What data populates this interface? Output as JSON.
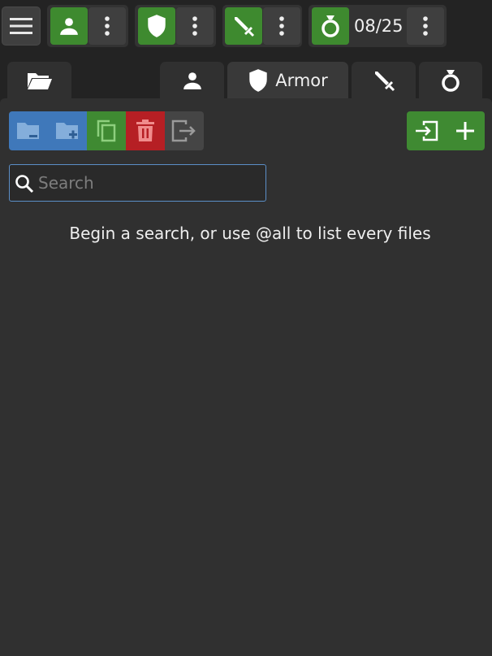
{
  "app": {
    "accent_green": "#3e8a2f",
    "accent_blue": "#3f78ba",
    "accent_red": "#b61f24",
    "background": "#232323"
  },
  "topbar": {
    "menu_icon": "hamburger-icon",
    "groups": [
      {
        "icon": "person-icon",
        "more_icon": "more-vertical-icon"
      },
      {
        "icon": "shield-icon",
        "more_icon": "more-vertical-icon"
      },
      {
        "icon": "sword-icon",
        "more_icon": "more-vertical-icon"
      },
      {
        "icon": "ring-icon",
        "counter": "08/25",
        "more_icon": "more-vertical-icon"
      }
    ]
  },
  "tabs": [
    {
      "icon": "folder-open-icon",
      "label": ""
    },
    {
      "icon": "person-icon",
      "label": ""
    },
    {
      "icon": "shield-icon",
      "label": "Armor"
    },
    {
      "icon": "sword-icon",
      "label": ""
    },
    {
      "icon": "ring-icon",
      "label": ""
    }
  ],
  "toolbar": {
    "left_tools": [
      {
        "icon": "folder-remove-icon"
      },
      {
        "icon": "folder-add-icon"
      },
      {
        "icon": "copy-icon"
      },
      {
        "icon": "trash-icon"
      },
      {
        "icon": "export-icon"
      }
    ],
    "right_tools": [
      {
        "icon": "import-icon"
      },
      {
        "icon": "plus-icon"
      }
    ]
  },
  "search": {
    "placeholder": "Search",
    "value": ""
  },
  "hint_text": "Begin a search, or use @all to list every files"
}
